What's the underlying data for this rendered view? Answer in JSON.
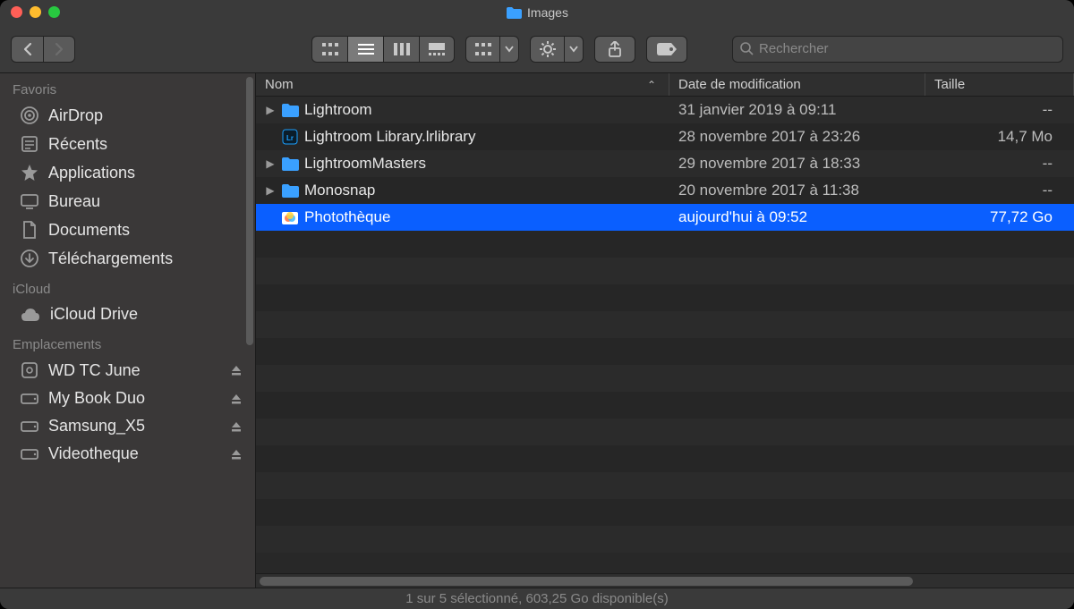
{
  "window": {
    "title": "Images"
  },
  "search": {
    "placeholder": "Rechercher"
  },
  "sidebar": {
    "sections": [
      {
        "title": "Favoris",
        "items": [
          {
            "label": "AirDrop"
          },
          {
            "label": "Récents"
          },
          {
            "label": "Applications"
          },
          {
            "label": "Bureau"
          },
          {
            "label": "Documents"
          },
          {
            "label": "Téléchargements"
          }
        ]
      },
      {
        "title": "iCloud",
        "items": [
          {
            "label": "iCloud Drive"
          }
        ]
      },
      {
        "title": "Emplacements",
        "items": [
          {
            "label": "WD TC June"
          },
          {
            "label": "My Book Duo"
          },
          {
            "label": "Samsung_X5"
          },
          {
            "label": "Videotheque"
          }
        ]
      }
    ]
  },
  "columns": {
    "name": "Nom",
    "date": "Date de modification",
    "size": "Taille"
  },
  "rows": [
    {
      "name": "Lightroom",
      "date": "31 janvier 2019 à 09:11",
      "size": "--",
      "kind": "folder",
      "expandable": true
    },
    {
      "name": "Lightroom Library.lrlibrary",
      "date": "28 novembre 2017 à 23:26",
      "size": "14,7 Mo",
      "kind": "lrlib",
      "expandable": false
    },
    {
      "name": "LightroomMasters",
      "date": "29 novembre 2017 à 18:33",
      "size": "--",
      "kind": "folder",
      "expandable": true
    },
    {
      "name": "Monosnap",
      "date": "20 novembre 2017 à 11:38",
      "size": "--",
      "kind": "folder",
      "expandable": true
    },
    {
      "name": "Photothèque",
      "date": "aujourd'hui à 09:52",
      "size": "77,72 Go",
      "kind": "photoslib",
      "expandable": false,
      "selected": true
    }
  ],
  "status": "1 sur 5 sélectionné, 603,25 Go disponible(s)"
}
